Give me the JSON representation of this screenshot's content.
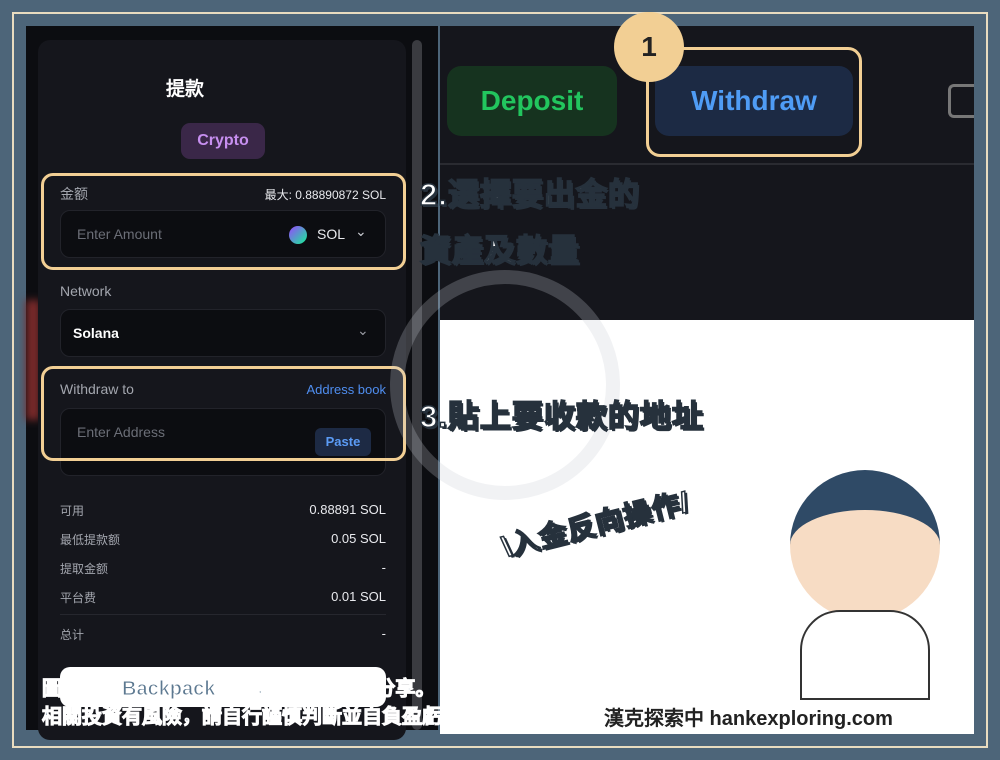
{
  "panel": {
    "title": "提款",
    "crypto_tab": "Crypto",
    "amount_label": "金额",
    "max_label": "最大: 0.88890872 SOL",
    "amount_placeholder": "Enter Amount",
    "asset": "SOL",
    "network_label": "Network",
    "network_value": "Solana",
    "withdraw_to_label": "Withdraw to",
    "address_book": "Address book",
    "address_placeholder": "Enter Address",
    "paste": "Paste",
    "summary": [
      {
        "label": "可用",
        "value": "0.88891 SOL"
      },
      {
        "label": "最低提款额",
        "value": "0.05 SOL"
      },
      {
        "label": "提取金额",
        "value": "-"
      },
      {
        "label": "平台费",
        "value": "0.01 SOL"
      }
    ],
    "total": {
      "label": "总计",
      "value": "-"
    }
  },
  "tabs": {
    "deposit": "Deposit",
    "withdraw": "Withdraw"
  },
  "annotations": {
    "step1": "1",
    "step2_line1": "2.選擇要出金的",
    "step2_line2": "資產及數量",
    "step3": "3.貼上要收款的地址",
    "reverse": "\\入金反向操作/"
  },
  "footer": {
    "line1": "圖片取自Backpack官網，僅用作經驗分享。",
    "line2": "相關投資有風險，請自行謹慎判斷並自負盈虧",
    "brand": "漢克探索中 hankexploring.com"
  },
  "colors": {
    "highlight": "#f2cf94",
    "deposit": "#22c55e",
    "withdraw": "#4f9cf5",
    "frame": "#4d6579"
  }
}
